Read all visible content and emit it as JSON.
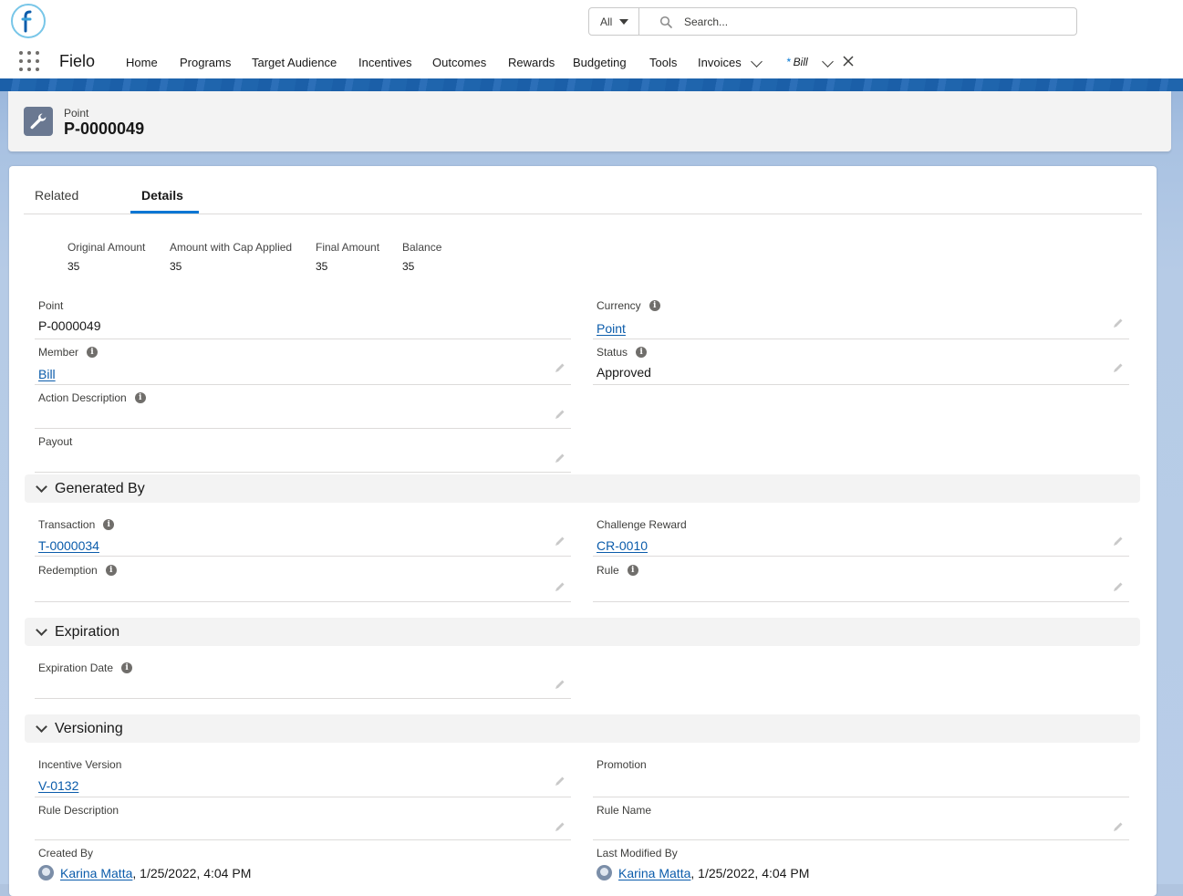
{
  "header": {
    "search_scope": "All",
    "search_placeholder": "Search..."
  },
  "nav": {
    "app_name": "Fielo",
    "items": [
      "Home",
      "Programs",
      "Target Audience",
      "Incentives",
      "Outcomes",
      "Rewards",
      "Budgeting",
      "Tools",
      "Invoices"
    ],
    "open_tab": {
      "mark": "*",
      "label": "Bill"
    }
  },
  "record": {
    "type": "Point",
    "title": "P-0000049"
  },
  "tabs": [
    "Related",
    "Details"
  ],
  "active_tab": "Details",
  "highlights": [
    {
      "label": "Original Amount",
      "value": "35"
    },
    {
      "label": "Amount with Cap Applied",
      "value": "35"
    },
    {
      "label": "Final Amount",
      "value": "35"
    },
    {
      "label": "Balance",
      "value": "35"
    }
  ],
  "fields": {
    "point": {
      "label": "Point",
      "value": "P-0000049"
    },
    "currency": {
      "label": "Currency",
      "value": "Point"
    },
    "member": {
      "label": "Member",
      "value": "Bill"
    },
    "status": {
      "label": "Status",
      "value": "Approved"
    },
    "action_description": {
      "label": "Action Description",
      "value": ""
    },
    "payout": {
      "label": "Payout",
      "value": ""
    }
  },
  "sections": {
    "generated_by": {
      "title": "Generated By",
      "transaction": {
        "label": "Transaction",
        "value": "T-0000034"
      },
      "challenge_reward": {
        "label": "Challenge Reward",
        "value": "CR-0010"
      },
      "redemption": {
        "label": "Redemption",
        "value": ""
      },
      "rule": {
        "label": "Rule",
        "value": ""
      }
    },
    "expiration": {
      "title": "Expiration",
      "expiration_date": {
        "label": "Expiration Date",
        "value": ""
      }
    },
    "versioning": {
      "title": "Versioning",
      "incentive_version": {
        "label": "Incentive Version",
        "value": "V-0132"
      },
      "promotion": {
        "label": "Promotion",
        "value": ""
      },
      "rule_description": {
        "label": "Rule Description",
        "value": ""
      },
      "rule_name": {
        "label": "Rule Name",
        "value": ""
      }
    }
  },
  "audit": {
    "created_by": {
      "label": "Created By",
      "user": "Karina Matta",
      "date": ", 1/25/2022, 4:04 PM"
    },
    "last_modified_by": {
      "label": "Last Modified By",
      "user": "Karina Matta",
      "date": ", 1/25/2022, 4:04 PM"
    }
  },
  "icons": {
    "info": "info-icon",
    "edit": "pencil-icon",
    "record": "wrench-icon"
  },
  "colors": {
    "link": "#0b5cab",
    "active_tab": "#0176d3",
    "brand_band": "#1b5fa8"
  }
}
